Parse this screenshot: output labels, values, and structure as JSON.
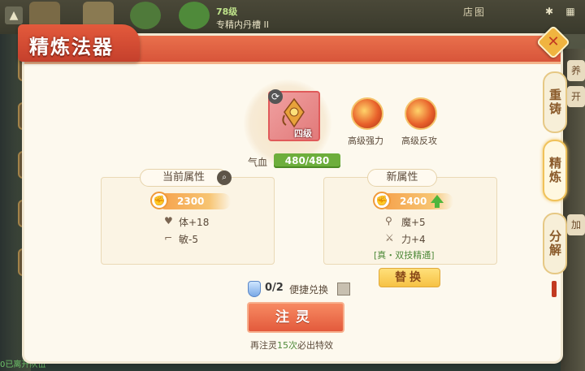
{
  "background": {
    "level": "78级",
    "slot": "专精内丹槽 II",
    "map_label": "店图",
    "bottom_text": "0已离开队伍",
    "right_btn_1": "养",
    "right_btn_2": "开",
    "right_btn_3": "加"
  },
  "panel": {
    "title": "精炼法器",
    "close_icon": "close-icon"
  },
  "side_tabs": [
    {
      "label": "重铸",
      "active": false
    },
    {
      "label": "精炼",
      "active": true
    },
    {
      "label": "分解",
      "active": false
    }
  ],
  "item": {
    "grade": "四级",
    "hp_label": "气血",
    "hp_value": "480/480",
    "skills": [
      {
        "label": "高级强力",
        "icon": "fist-fire-icon"
      },
      {
        "label": "高级反攻",
        "icon": "counter-fire-icon"
      }
    ]
  },
  "current": {
    "title": "当前属性",
    "power": "2300",
    "stats": [
      {
        "icon": "heart-icon",
        "text": "体+18"
      },
      {
        "icon": "boot-icon",
        "text": "敏-5"
      }
    ]
  },
  "new": {
    "title": "新属性",
    "power": "2400",
    "stats": [
      {
        "icon": "wand-icon",
        "text": "魔+5"
      },
      {
        "icon": "sword-icon",
        "text": "力+4"
      }
    ],
    "skill_line": "[真・双技精通]"
  },
  "actions": {
    "replace_label": "替换",
    "count_used": "0/2",
    "quick_exchange": "便捷兑换",
    "infuse_label": "注灵",
    "hint_prefix": "再注灵",
    "hint_num": "15次",
    "hint_suffix": "必出特效"
  },
  "colors": {
    "header": "#e35a3c",
    "hp_bar": "#6dae3c",
    "accent_gold": "#f6c244",
    "green_text": "#4f8a3a"
  }
}
